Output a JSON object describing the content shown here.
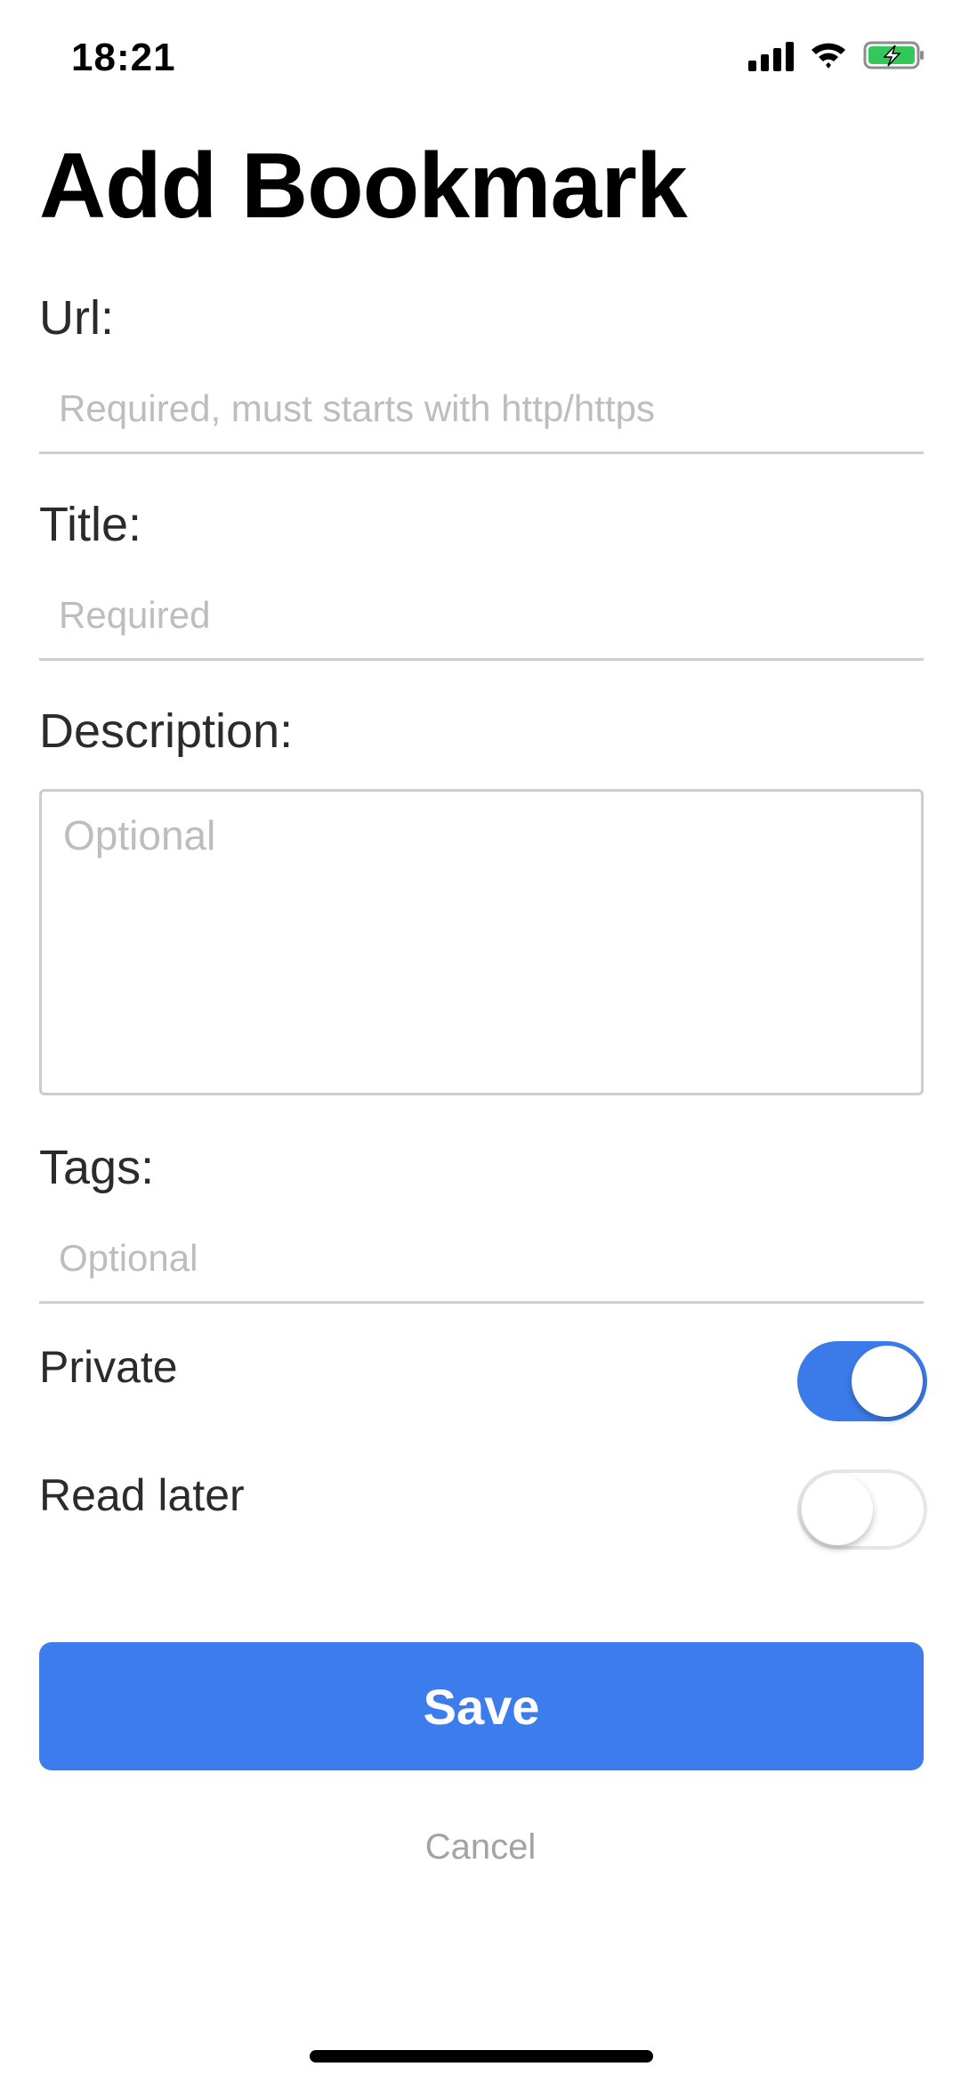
{
  "status_bar": {
    "time": "18:21",
    "icons": [
      "signal-icon",
      "wifi-icon",
      "battery-charging-icon"
    ],
    "battery_color": "#34c759"
  },
  "page": {
    "title": "Add Bookmark"
  },
  "form": {
    "url": {
      "label": "Url:",
      "placeholder": "Required, must starts with http/https",
      "value": ""
    },
    "title": {
      "label": "Title:",
      "placeholder": "Required",
      "value": ""
    },
    "description": {
      "label": "Description:",
      "placeholder": "Optional",
      "value": ""
    },
    "tags": {
      "label": "Tags:",
      "placeholder": "Optional",
      "value": ""
    }
  },
  "toggles": {
    "private": {
      "label": "Private",
      "on": true
    },
    "read_later": {
      "label": "Read later",
      "on": false
    }
  },
  "actions": {
    "save_label": "Save",
    "cancel_label": "Cancel"
  },
  "colors": {
    "accent": "#3d7cec",
    "placeholder": "#bdbdbd"
  }
}
